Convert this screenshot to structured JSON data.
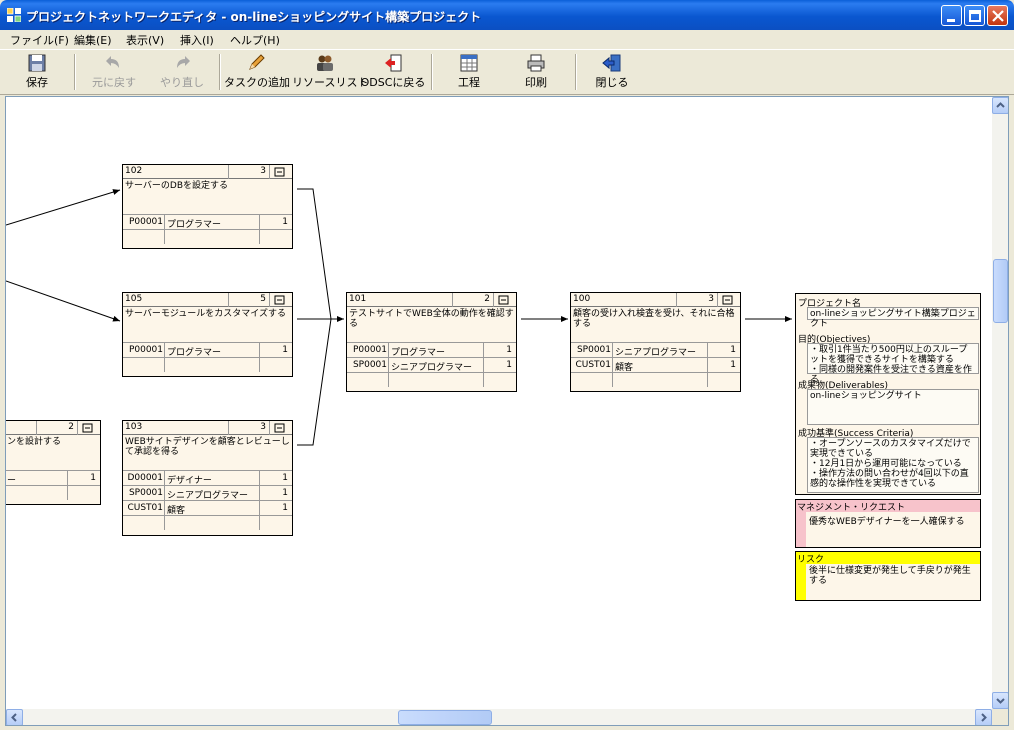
{
  "window": {
    "title": "プロジェクトネットワークエディタ - on-lineショッピングサイト構築プロジェクト"
  },
  "menu": [
    "ファイル(F)",
    "編集(E)",
    "表示(V)",
    "挿入(I)",
    "ヘルプ(H)"
  ],
  "toolbar": {
    "save": "保存",
    "undo": "元に戻す",
    "redo": "やり直し",
    "add_task": "タスクの追加",
    "resource_list": "リソースリスト",
    "back_odsc": "ODSCに戻る",
    "process": "工程",
    "print": "印刷",
    "close": "閉じる"
  },
  "tasks": [
    {
      "id": "102",
      "duration": "3",
      "name": "サーバーのDBを設定する",
      "resources": [
        {
          "rid": "P00001",
          "role": "プログラマー",
          "qty": "1"
        }
      ]
    },
    {
      "id": "105",
      "duration": "5",
      "name": "サーバーモジュールをカスタマイズする",
      "resources": [
        {
          "rid": "P00001",
          "role": "プログラマー",
          "qty": "1"
        }
      ]
    },
    {
      "id": "103",
      "duration": "3",
      "name": "WEBサイトデザインを顧客とレビューして承認を得る",
      "resources": [
        {
          "rid": "D00001",
          "role": "デザイナー",
          "qty": "1"
        },
        {
          "rid": "SP0001",
          "role": "シニアプログラマー",
          "qty": "1"
        },
        {
          "rid": "CUST01",
          "role": "顧客",
          "qty": "1"
        }
      ]
    },
    {
      "id": "101",
      "duration": "2",
      "name": "テストサイトでWEB全体の動作を確認する",
      "resources": [
        {
          "rid": "P00001",
          "role": "プログラマー",
          "qty": "1"
        },
        {
          "rid": "SP0001",
          "role": "シニアプログラマー",
          "qty": "1"
        }
      ]
    },
    {
      "id": "100",
      "duration": "3",
      "name": "顧客の受け入れ検査を受け、それに合格する",
      "resources": [
        {
          "rid": "SP0001",
          "role": "シニアプログラマー",
          "qty": "1"
        },
        {
          "rid": "CUST01",
          "role": "顧客",
          "qty": "1"
        }
      ]
    },
    {
      "id": "",
      "duration": "2",
      "name": "ンを設計する",
      "resources": [
        {
          "rid": "",
          "role": "ー",
          "qty": "1"
        }
      ]
    }
  ],
  "project": {
    "name_label": "プロジェクト名",
    "name": "on-lineショッピングサイト構築プロジェクト",
    "objectives_label": "目的(Objectives)",
    "objectives": [
      "・取引1件当たり500円以上のスループットを獲得できるサイトを構築する",
      "・同様の開発案件を受注できる資産を作る"
    ],
    "deliverables_label": "成果物(Deliverables)",
    "deliverables": "on-lineショッピングサイト",
    "criteria_label": "成功基準(Success Criteria)",
    "criteria": [
      "・オープンソースのカスタマイズだけで実現できている",
      "・12月1日から運用可能になっている",
      "・操作方法の問い合わせが4回以下の直感的な操作性を実現できている"
    ]
  },
  "management_request": {
    "label": "マネジメント・リクエスト",
    "text": "優秀なWEBデザイナーを一人確保する"
  },
  "risk": {
    "label": "リスク",
    "text": "後半に仕様変更が発生して手戻りが発生する"
  },
  "colors": {
    "title_bar": "#0a57d0",
    "task_bg": "#fdf6e9",
    "management_header": "#f7c3cb",
    "risk_header": "#ffff00"
  }
}
